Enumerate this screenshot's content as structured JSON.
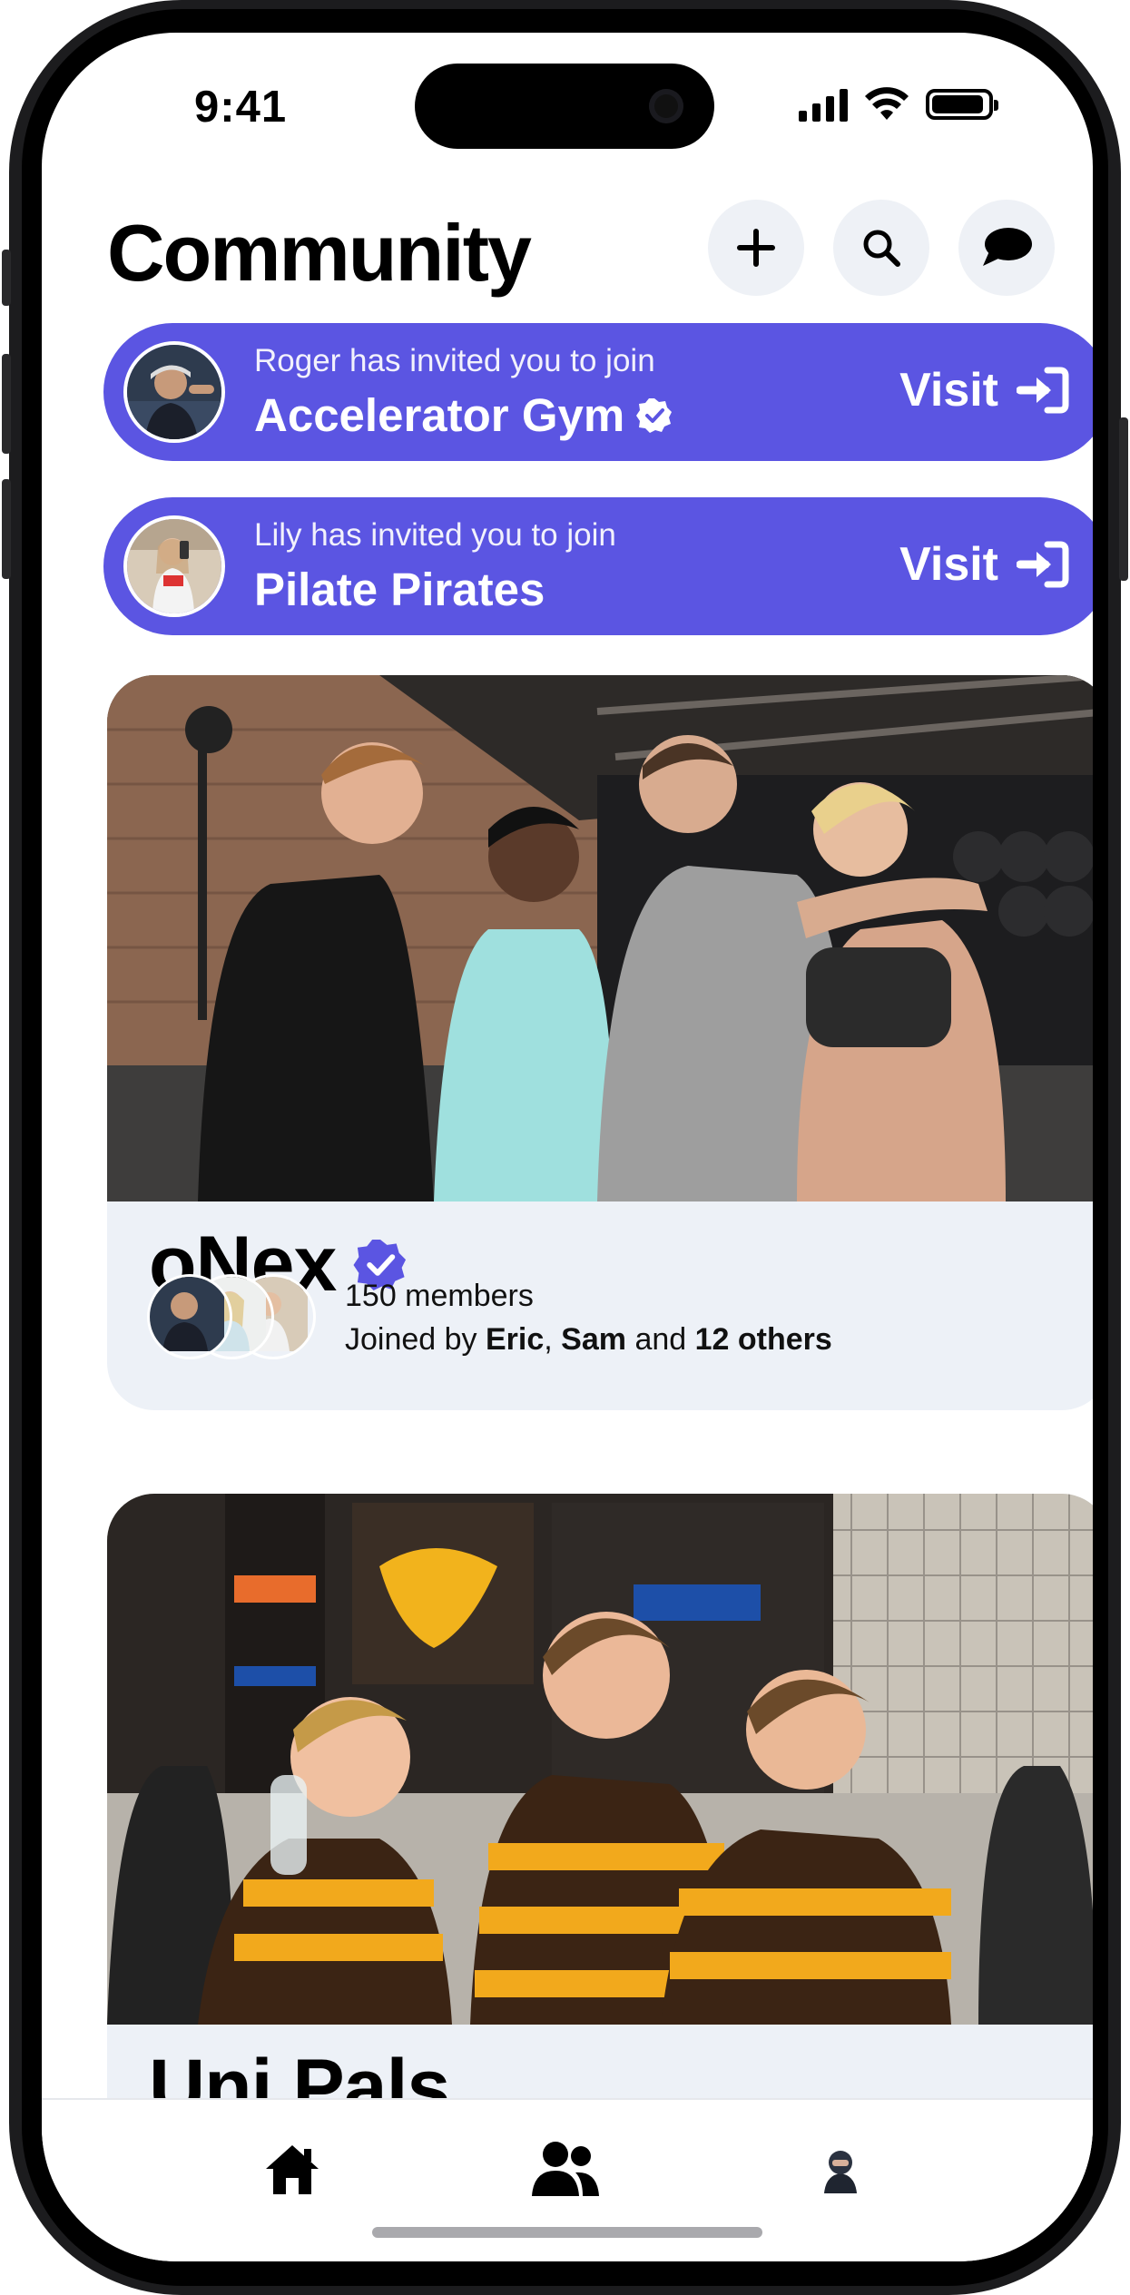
{
  "status_bar": {
    "time": "9:41"
  },
  "header": {
    "title": "Community"
  },
  "header_icons": [
    "plus-icon",
    "search-icon",
    "chat-bubble-icon"
  ],
  "invites": [
    {
      "subtitle": "Roger has invited you to join",
      "community": "Accelerator Gym",
      "verified": true,
      "action": "Visit"
    },
    {
      "subtitle": "Lily has invited you to join",
      "community": "Pilate Pirates",
      "verified": false,
      "action": "Visit"
    }
  ],
  "communities": [
    {
      "name": "oNex",
      "verified": true,
      "members_count": "150 members",
      "joined_prefix": "Joined by",
      "joined_names": [
        "Eric",
        "Sam"
      ],
      "joined_and": "and",
      "joined_others": "12 others"
    },
    {
      "name": "Uni Pals"
    }
  ],
  "tabs": [
    "home-icon",
    "people-icon",
    "profile-avatar"
  ],
  "colors": {
    "accent": "#5b55e2",
    "card_bg": "#edf1f7",
    "icon_button_bg": "#eef1f6"
  }
}
